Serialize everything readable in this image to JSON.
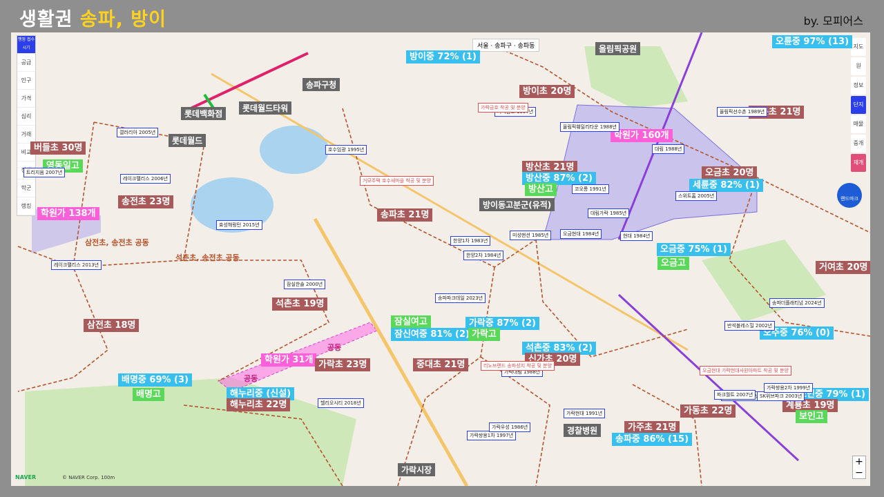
{
  "title": {
    "prefix": "생활권 ",
    "highlight": "송파, 방이"
  },
  "byline": "by. 모피어스",
  "breadcrumb": "서울 · 송파구 · 송파동",
  "sidebar": [
    "행정 접수시기",
    "공급",
    "인구",
    "가격",
    "심리",
    "거래",
    "비교",
    "정책",
    "학군",
    "랭킹"
  ],
  "rightbar": [
    "지도",
    "원",
    "정보",
    "단지",
    "매물",
    "중개",
    "재개"
  ],
  "fab_label": "랜드마크",
  "zoom": {
    "in": "+",
    "out": "−"
  },
  "naver": "NAVER",
  "copyright": "© NAVER Corp.",
  "scale": "100m",
  "colors": {
    "map_bg": "#f3efe8",
    "water": "#aad3f0",
    "park": "#cfe8b9",
    "zone_purple": "#9a8ff0",
    "zone_pink": "#ff6ee6",
    "road_main": "#f4c56a",
    "boundary": "#b5532c"
  },
  "labels": [
    {
      "text": "방이중 72% (1)",
      "bg": "#38bfee",
      "fg": "#fff"
    },
    {
      "text": "방이초 20명",
      "bg": "#a85a5a",
      "fg": "#fff"
    },
    {
      "text": "오륜중 97% (13)",
      "bg": "#38bfee",
      "fg": "#fff"
    },
    {
      "text": "오륜초 21명",
      "bg": "#a85a5a",
      "fg": "#fff"
    },
    {
      "text": "학원가 160개",
      "bg": "#ff5fd8",
      "fg": "#fff"
    },
    {
      "text": "방산초 21명",
      "bg": "#a85a5a",
      "fg": "#fff"
    },
    {
      "text": "방산중 87% (2)",
      "bg": "#38bfee",
      "fg": "#fff"
    },
    {
      "text": "방산고",
      "bg": "#5ad85a",
      "fg": "#fff"
    },
    {
      "text": "오금초 20명",
      "bg": "#a85a5a",
      "fg": "#fff"
    },
    {
      "text": "세륜중 82% (1)",
      "bg": "#38bfee",
      "fg": "#fff"
    },
    {
      "text": "버들초 30명",
      "bg": "#a85a5a",
      "fg": "#fff"
    },
    {
      "text": "영동일고",
      "bg": "#5ad85a",
      "fg": "#fff"
    },
    {
      "text": "송전초 23명",
      "bg": "#a85a5a",
      "fg": "#fff"
    },
    {
      "text": "학원가 138개",
      "bg": "#ff5fd8",
      "fg": "#fff"
    },
    {
      "text": "송파초 21명",
      "bg": "#a85a5a",
      "fg": "#fff"
    },
    {
      "text": "오금중 75% (1)",
      "bg": "#38bfee",
      "fg": "#fff"
    },
    {
      "text": "오금고",
      "bg": "#5ad85a",
      "fg": "#fff"
    },
    {
      "text": "거여초 20명",
      "bg": "#a85a5a",
      "fg": "#fff"
    },
    {
      "text": "석촌초 19명",
      "bg": "#a85a5a",
      "fg": "#fff"
    },
    {
      "text": "삼전초 18명",
      "bg": "#a85a5a",
      "fg": "#fff"
    },
    {
      "text": "잠실여고",
      "bg": "#5ad85a",
      "fg": "#fff"
    },
    {
      "text": "잠신여중 81% (2)",
      "bg": "#38bfee",
      "fg": "#fff"
    },
    {
      "text": "가락중 87% (2)",
      "bg": "#38bfee",
      "fg": "#fff"
    },
    {
      "text": "가락고",
      "bg": "#5ad85a",
      "fg": "#fff"
    },
    {
      "text": "오주중 76% (0)",
      "bg": "#38bfee",
      "fg": "#fff"
    },
    {
      "text": "석촌중 83% (2)",
      "bg": "#38bfee",
      "fg": "#fff"
    },
    {
      "text": "신가초 20명",
      "bg": "#a85a5a",
      "fg": "#fff"
    },
    {
      "text": "학원가 31개",
      "bg": "#ff5fd8",
      "fg": "#fff"
    },
    {
      "text": "가락초 23명",
      "bg": "#a85a5a",
      "fg": "#fff"
    },
    {
      "text": "중대초 21명",
      "bg": "#a85a5a",
      "fg": "#fff"
    },
    {
      "text": "배명중 69% (3)",
      "bg": "#38bfee",
      "fg": "#fff"
    },
    {
      "text": "배명고",
      "bg": "#5ad85a",
      "fg": "#fff"
    },
    {
      "text": "해누리중 (신설)",
      "bg": "#38bfee",
      "fg": "#fff"
    },
    {
      "text": "해누리초 22명",
      "bg": "#a85a5a",
      "fg": "#fff"
    },
    {
      "text": "보인중 79% (1)",
      "bg": "#38bfee",
      "fg": "#fff"
    },
    {
      "text": "계룡초 19명",
      "bg": "#a85a5a",
      "fg": "#fff"
    },
    {
      "text": "보인고",
      "bg": "#5ad85a",
      "fg": "#fff"
    },
    {
      "text": "가동초 22명",
      "bg": "#a85a5a",
      "fg": "#fff"
    },
    {
      "text": "가주초 21명",
      "bg": "#a85a5a",
      "fg": "#fff"
    },
    {
      "text": "송파중 86% (15)",
      "bg": "#38bfee",
      "fg": "#fff"
    }
  ],
  "landmarks": [
    "올림픽공원",
    "송파구청",
    "롯데백화점",
    "롯데월드타워",
    "롯데월드",
    "방이동고분군(유적)",
    "경찰병원",
    "가락시장"
  ],
  "zones": [
    "삼전초, 송전초 공동",
    "석촌초, 송전초 공동",
    "공동",
    "공동"
  ],
  "apartments": [
    "갤러리아 2005년",
    "트리지움 2007년",
    "레이크팰리스 2006년",
    "레이크팰리스 2013년",
    "호수임광 1995년",
    "효성해링턴 2015년",
    "잠실한솔 2000년",
    "한양1차 1983년",
    "한양2차 1984년",
    "미성맨션 1985년",
    "올림픽훼밀리타운 1988년",
    "대림 1988년",
    "올림픽선수촌 1989년",
    "스위트홈 2005년",
    "현대 1984년",
    "코오롱 1991년",
    "대림가락 1985년",
    "헬리오시티 2018년",
    "송파파크데일 2023년",
    "가락쌍용1차 1997년",
    "가락현대 1991년",
    "가락우성 1986년",
    "가락대림 1988년",
    "가락금호 1997년",
    "오금현대 1984년",
    "파크리오 2008년",
    "송파더플래티넘 2024년",
    "반석블레스힐 2002년",
    "파크월트 2007년",
    "SK위브파크 2003년",
    "가락쌍용2차 1999년"
  ],
  "notices": [
    "거모주택 호수새마을 착공 및 분양",
    "리노브랜드 송파성지 착공 및 분양",
    "오금현대 가락현대사원아파트 착공 및 분양",
    "가락금호 착공 및 분양"
  ]
}
